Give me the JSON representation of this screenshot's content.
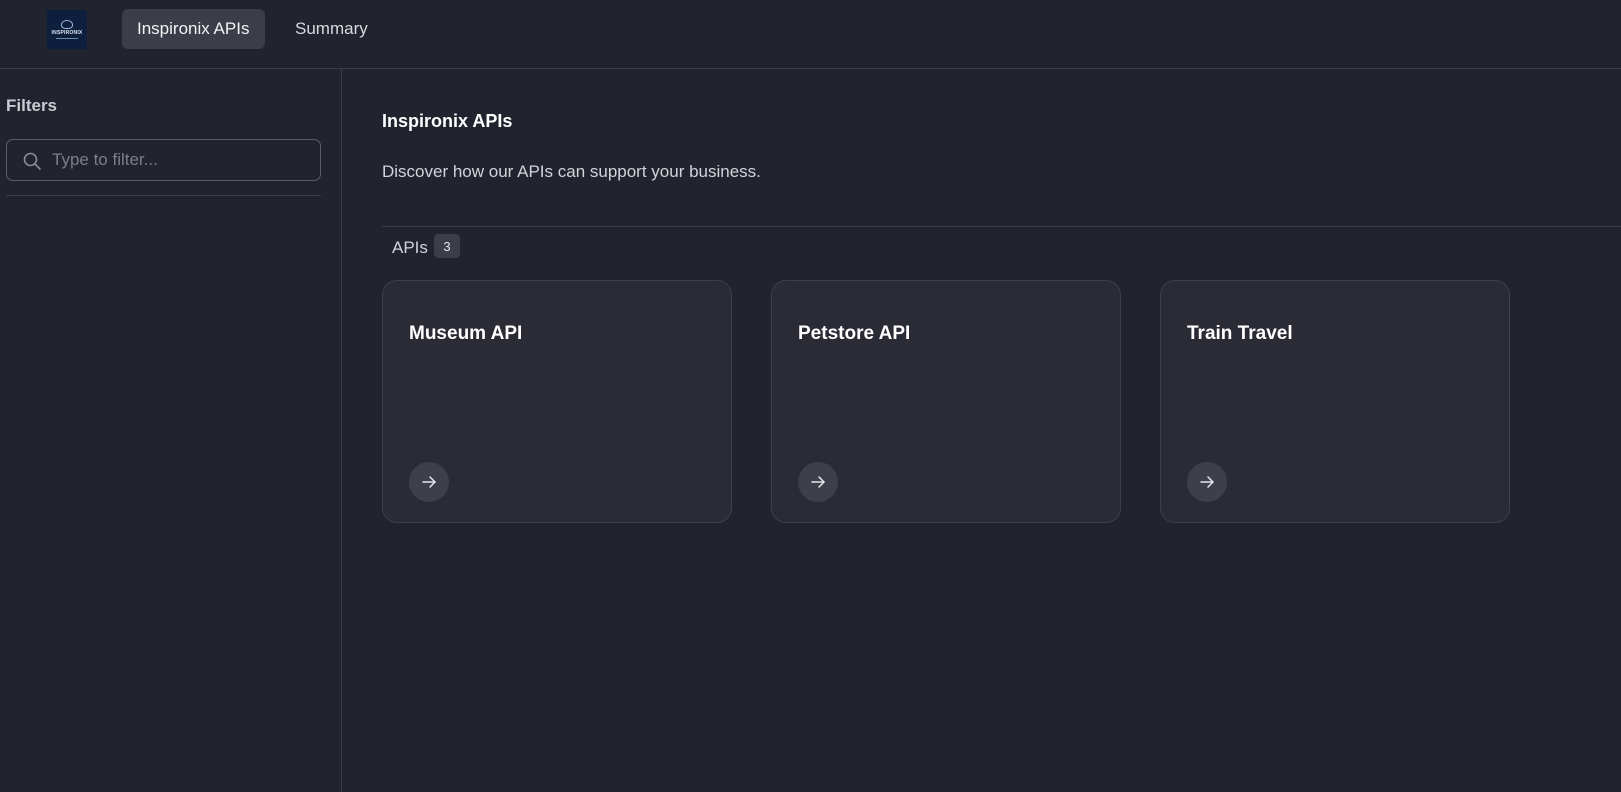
{
  "header": {
    "logo_text": "INSPIRONIX",
    "tabs": [
      {
        "label": "Inspironix APIs",
        "active": true
      },
      {
        "label": "Summary",
        "active": false
      }
    ]
  },
  "sidebar": {
    "title": "Filters",
    "filter": {
      "placeholder": "Type to filter...",
      "value": ""
    }
  },
  "main": {
    "title": "Inspironix APIs",
    "description": "Discover how our APIs can support your business.",
    "apis_label": "APIs",
    "apis_count": "3",
    "cards": [
      {
        "title": "Museum API",
        "icon": "arrow-right-icon"
      },
      {
        "title": "Petstore API",
        "icon": "arrow-right-icon"
      },
      {
        "title": "Train Travel",
        "icon": "arrow-right-icon"
      }
    ]
  },
  "colors": {
    "background": "#21242e",
    "card_background": "#2a2b35",
    "active_tab": "#3b3d48",
    "border": "#3a3d47"
  }
}
